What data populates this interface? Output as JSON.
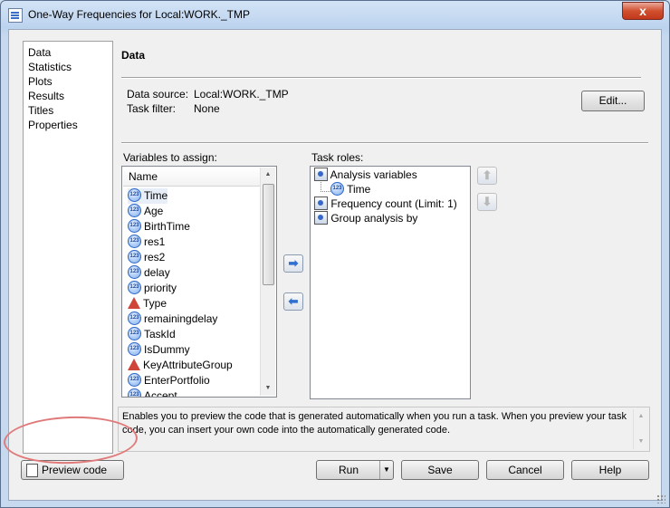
{
  "window": {
    "title": "One-Way Frequencies for Local:WORK._TMP",
    "close_label": "x"
  },
  "nav": {
    "items": [
      "Data",
      "Statistics",
      "Plots",
      "Results",
      "Titles",
      "Properties"
    ]
  },
  "section": {
    "title": "Data",
    "data_source_label": "Data source:",
    "data_source_value": "Local:WORK._TMP",
    "task_filter_label": "Task filter:",
    "task_filter_value": "None",
    "edit_button": "Edit..."
  },
  "variables": {
    "label": "Variables to assign:",
    "column_header": "Name",
    "items": [
      {
        "name": "Time",
        "type": "numeric"
      },
      {
        "name": "Age",
        "type": "numeric"
      },
      {
        "name": "BirthTime",
        "type": "numeric"
      },
      {
        "name": "res1",
        "type": "numeric"
      },
      {
        "name": "res2",
        "type": "numeric"
      },
      {
        "name": "delay",
        "type": "numeric"
      },
      {
        "name": "priority",
        "type": "numeric"
      },
      {
        "name": "Type",
        "type": "character"
      },
      {
        "name": "remainingdelay",
        "type": "numeric"
      },
      {
        "name": "TaskId",
        "type": "numeric"
      },
      {
        "name": "IsDummy",
        "type": "numeric"
      },
      {
        "name": "KeyAttributeGroup",
        "type": "character"
      },
      {
        "name": "EnterPortfolio",
        "type": "numeric"
      },
      {
        "name": "Accept",
        "type": "numeric"
      }
    ]
  },
  "task_roles": {
    "label": "Task roles:",
    "analysis_variables": "Analysis variables",
    "assigned_variable": "Time",
    "frequency_count": "Frequency count  (Limit: 1)",
    "group_analysis": "Group analysis by"
  },
  "help": {
    "text": "Enables you to preview the code that is generated automatically when you run a task. When you preview your task code, you can insert your own code into the automatically generated code."
  },
  "buttons": {
    "preview_code": "Preview code",
    "run": "Run",
    "save": "Save",
    "cancel": "Cancel",
    "help": "Help"
  },
  "colors": {
    "highlight_ellipse": "#e07a7a",
    "close_button": "#d0502f"
  }
}
